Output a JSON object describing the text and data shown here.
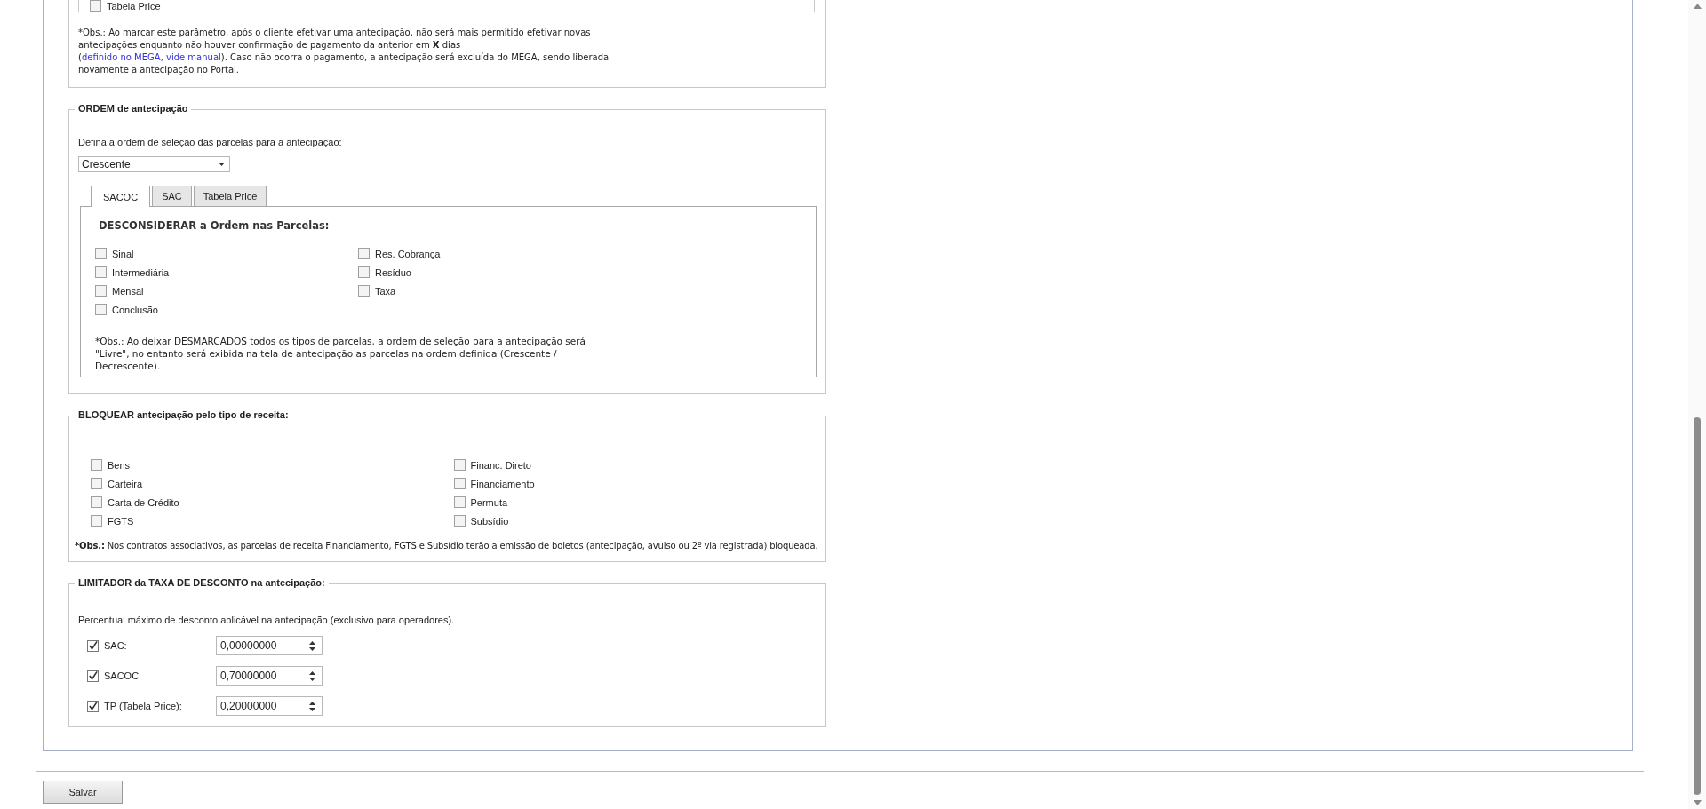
{
  "top_section": {
    "checkbox": {
      "label": "Tabela Price",
      "checked": false
    },
    "note": {
      "before": "*Obs.: Ao marcar este parâmetro, após o cliente efetivar uma antecipação, não será mais permitido efetivar novas antecipações enquanto não houver confirmação de pagamento da anterior em **X** dias (",
      "link": "definido no MEGA, vide manual",
      "after": "). Caso não ocorra o pagamento, a antecipação será excluída do MEGA, sendo liberada novamente a antecipação no Portal."
    }
  },
  "order_section": {
    "legend": "ORDEM de antecipação",
    "label": "Defina a ordem de seleção das parcelas para a antecipação:",
    "select": {
      "value": "Crescente"
    },
    "tabs": [
      {
        "label": "SACOC",
        "selected": true
      },
      {
        "label": "SAC",
        "selected": false
      },
      {
        "label": "Tabela Price",
        "selected": false
      }
    ],
    "panel": {
      "heading": "DESCONSIDERAR a Ordem nas Parcelas:",
      "columns": [
        [
          {
            "label": "Sinal",
            "checked": false
          },
          {
            "label": "Intermediária",
            "checked": false
          },
          {
            "label": "Mensal",
            "checked": false
          },
          {
            "label": "Conclusão",
            "checked": false
          }
        ],
        [
          {
            "label": "Res. Cobrança",
            "checked": false
          },
          {
            "label": "Resíduo",
            "checked": false
          },
          {
            "label": "Taxa",
            "checked": false
          }
        ]
      ],
      "note": "*Obs.: Ao deixar DESMARCADOS todos os tipos de parcelas, a ordem de seleção para a antecipação será \"Livre\", no entanto será exibida na tela de antecipação as parcelas na ordem definida (Crescente / Decrescente)."
    }
  },
  "block_section": {
    "legend": "BLOQUEAR antecipação pelo tipo de receita:",
    "columns": [
      [
        {
          "label": "Bens",
          "checked": false
        },
        {
          "label": "Carteira",
          "checked": false
        },
        {
          "label": "Carta de Crédito",
          "checked": false
        },
        {
          "label": "FGTS",
          "checked": false
        }
      ],
      [
        {
          "label": "Financ. Direto",
          "checked": false
        },
        {
          "label": "Financiamento",
          "checked": false
        },
        {
          "label": "Permuta",
          "checked": false
        },
        {
          "label": "Subsídio",
          "checked": false
        }
      ]
    ],
    "note_label": "*Obs.:",
    "note": " Nos contratos associativos, as parcelas de receita Financiamento, FGTS e Subsídio terão a emissão de boletos (antecipação, avulso ou 2º via registrada) bloqueada."
  },
  "limit_section": {
    "legend": "LIMITADOR da TAXA DE DESCONTO na antecipação:",
    "description": "Percentual máximo de desconto aplicável na antecipação (exclusivo para operadores).",
    "rows": [
      {
        "label": "SAC:",
        "checked": true,
        "value": "0,00000000"
      },
      {
        "label": "SACOC:",
        "checked": true,
        "value": "0,70000000"
      },
      {
        "label": "TP (Tabela Price):",
        "checked": true,
        "value": "0,20000000"
      }
    ]
  },
  "save_button": "Salvar"
}
